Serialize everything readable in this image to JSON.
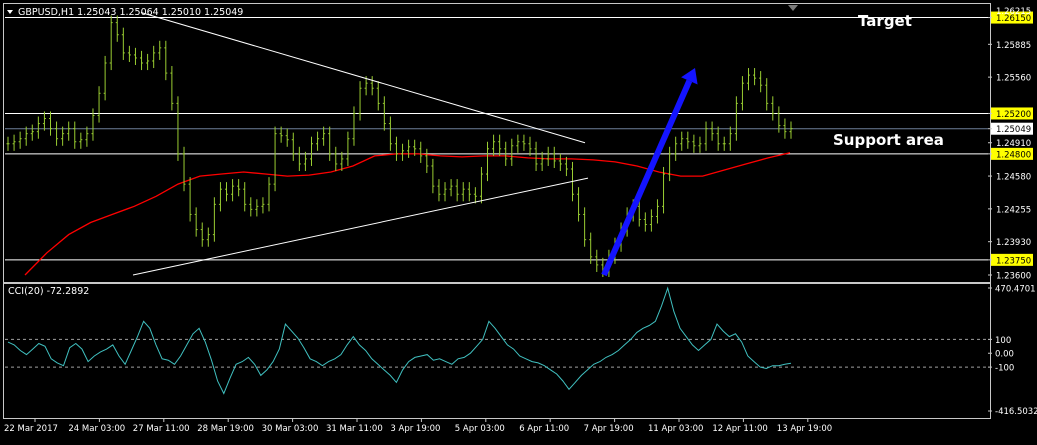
{
  "chart_data": [
    {
      "type": "candlestick",
      "title": "GBPUSD,H1  1.25043 1.25064 1.25010 1.25049",
      "symbol": "GBPUSD",
      "timeframe": "H1",
      "ohlc": {
        "open": 1.25043,
        "high": 1.25064,
        "low": 1.2501,
        "close": 1.25049
      },
      "y_ticks": [
        "1.26150",
        "1.25885",
        "1.25560",
        "1.25200",
        "1.25049",
        "1.24910",
        "1.24800",
        "1.24580",
        "1.24255",
        "1.23930",
        "1.23750",
        "1.23600"
      ],
      "ylim": [
        1.236,
        1.26215
      ],
      "y_max_label": "1.26215",
      "x_ticks": [
        "22 Mar 2017",
        "24 Mar 03:00",
        "27 Mar 11:00",
        "28 Mar 19:00",
        "30 Mar 03:00",
        "31 Mar 11:00",
        "3 Apr 19:00",
        "5 Apr 03:00",
        "6 Apr 11:00",
        "7 Apr 19:00",
        "11 Apr 03:00",
        "12 Apr 11:00",
        "13 Apr 19:00"
      ],
      "horizontal_levels": [
        1.2615,
        1.252,
        1.248,
        1.2375
      ],
      "highlighted_levels": [
        "1.26150",
        "1.25200",
        "1.24800",
        "1.23750"
      ],
      "current_price": 1.25049,
      "annotations": [
        {
          "text": "Target"
        },
        {
          "text": "Support area"
        }
      ],
      "trendlines": [
        {
          "name": "descending",
          "from": {
            "x": "27 Mar 11:00",
            "y": 1.262
          },
          "to": {
            "x": "6 Apr 19:00",
            "y": 1.2491
          }
        },
        {
          "name": "ascending",
          "from": {
            "x": "24 Mar 03:00",
            "y": 1.236
          },
          "to": {
            "x": "7 Apr 11:00",
            "y": 1.2456
          }
        }
      ],
      "arrow": {
        "from": {
          "x": "7 Apr 19:00",
          "y": 1.236
        },
        "to": {
          "x": "11 Apr 11:00",
          "y": 1.2565
        },
        "color": "#1414ff"
      },
      "close_series": [
        1.249,
        1.2492,
        1.2495,
        1.25,
        1.2502,
        1.251,
        1.2515,
        1.2505,
        1.2495,
        1.25,
        1.2505,
        1.2492,
        1.2494,
        1.25,
        1.2518,
        1.254,
        1.257,
        1.261,
        1.2598,
        1.258,
        1.2578,
        1.2575,
        1.257,
        1.2572,
        1.258,
        1.2585,
        1.256,
        1.253,
        1.248,
        1.245,
        1.242,
        1.2405,
        1.2395,
        1.24,
        1.243,
        1.2445,
        1.244,
        1.2448,
        1.2445,
        1.243,
        1.2425,
        1.2428,
        1.243,
        1.245,
        1.25,
        1.2498,
        1.2494,
        1.248,
        1.247,
        1.2475,
        1.249,
        1.2495,
        1.25,
        1.248,
        1.247,
        1.2475,
        1.2495,
        1.252,
        1.2545,
        1.255,
        1.2545,
        1.253,
        1.251,
        1.249,
        1.248,
        1.2483,
        1.2487,
        1.2485,
        1.2478,
        1.2468,
        1.2448,
        1.244,
        1.2445,
        1.2448,
        1.244,
        1.2445,
        1.244,
        1.2438,
        1.246,
        1.2485,
        1.2492,
        1.2485,
        1.2475,
        1.2488,
        1.2492,
        1.249,
        1.2485,
        1.247,
        1.2475,
        1.248,
        1.2473,
        1.247,
        1.2465,
        1.244,
        1.242,
        1.2395,
        1.2378,
        1.237,
        1.2365,
        1.2378,
        1.239,
        1.2405,
        1.242,
        1.2428,
        1.2415,
        1.241,
        1.2418,
        1.2428,
        1.246,
        1.248,
        1.249,
        1.2495,
        1.2492,
        1.2488,
        1.249,
        1.2505,
        1.25,
        1.249,
        1.249,
        1.25,
        1.253,
        1.255,
        1.2558,
        1.2555,
        1.2548,
        1.253,
        1.252,
        1.2508,
        1.2502,
        1.2505
      ],
      "moving_average": {
        "color": "#ff0000",
        "values": [
          1.236,
          1.2382,
          1.24,
          1.2412,
          1.242,
          1.2428,
          1.2438,
          1.245,
          1.2458,
          1.246,
          1.2462,
          1.246,
          1.2458,
          1.2459,
          1.2462,
          1.2468,
          1.2478,
          1.248,
          1.248,
          1.2478,
          1.2477,
          1.2478,
          1.2478,
          1.2476,
          1.2475,
          1.2475,
          1.2474,
          1.2472,
          1.2468,
          1.2462,
          1.2458,
          1.2458,
          1.2464,
          1.247,
          1.2476,
          1.2481
        ]
      },
      "colors": {
        "candles": "#9acd32",
        "levels": "#ffffff",
        "level_label_bg": "#ffff00",
        "background": "#000000"
      }
    },
    {
      "type": "line",
      "title": "CCI(20) -72.2892",
      "indicator": "CCI(20)",
      "current_value": -72.2892,
      "y_ticks": [
        "470.4701",
        "100",
        "0.00",
        "-100",
        "-416.5032"
      ],
      "ylim": [
        -416.5032,
        470.4701
      ],
      "levels": [
        100,
        0,
        -100
      ],
      "series": [
        {
          "values": [
            80,
            60,
            20,
            -10,
            30,
            70,
            50,
            -40,
            -70,
            -90,
            40,
            70,
            30,
            -60,
            -20,
            10,
            30,
            60,
            -20,
            -80,
            20,
            120,
            230,
            180,
            60,
            -40,
            -50,
            -80,
            -20,
            60,
            140,
            180,
            80,
            -50,
            -200,
            -290,
            -180,
            -80,
            -60,
            -30,
            -80,
            -160,
            -120,
            -60,
            30,
            210,
            160,
            110,
            40,
            -40,
            -60,
            -90,
            -60,
            -40,
            -10,
            60,
            120,
            60,
            20,
            -40,
            -80,
            -120,
            -160,
            -210,
            -120,
            -60,
            -30,
            -20,
            -10,
            -50,
            -40,
            -60,
            -80,
            -40,
            -30,
            0,
            50,
            100,
            230,
            180,
            120,
            60,
            30,
            -20,
            -40,
            -60,
            -70,
            -90,
            -120,
            -150,
            -200,
            -260,
            -210,
            -160,
            -120,
            -80,
            -60,
            -30,
            -10,
            20,
            60,
            100,
            150,
            180,
            200,
            230,
            340,
            470,
            300,
            180,
            120,
            60,
            20,
            60,
            100,
            210,
            160,
            120,
            140,
            80,
            -20,
            -60,
            -100,
            -110,
            -90,
            -90,
            -80,
            -72
          ]
        }
      ],
      "colors": {
        "line": "#40c0c0",
        "levels": "#a0a0a0"
      }
    }
  ]
}
